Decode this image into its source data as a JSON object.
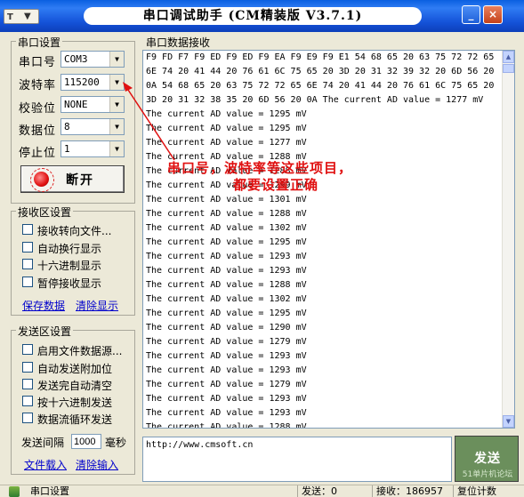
{
  "window": {
    "title": "串口调试助手 (CM精装版 V3.7.1)",
    "min_glyph": "_",
    "close_glyph": "×",
    "sysmenu_hammer": "T",
    "sysmenu_chevron": "▼"
  },
  "serial": {
    "group_title": "串口设置",
    "fields": [
      {
        "label": "串口号",
        "value": "COM3"
      },
      {
        "label": "波特率",
        "value": "115200"
      },
      {
        "label": "校验位",
        "value": "NONE"
      },
      {
        "label": "数据位",
        "value": "8"
      },
      {
        "label": "停止位",
        "value": "1"
      }
    ],
    "combo_arrow": "▼",
    "connect_button": "断开"
  },
  "recv_settings": {
    "group_title": "接收区设置",
    "options": [
      "接收转向文件...",
      "自动换行显示",
      "十六进制显示",
      "暂停接收显示"
    ],
    "save_link": "保存数据",
    "clear_link": "清除显示"
  },
  "send_settings": {
    "group_title": "发送区设置",
    "options": [
      "启用文件数据源...",
      "自动发送附加位",
      "发送完自动清空",
      "按十六进制发送",
      "数据流循环发送"
    ],
    "interval_label": "发送间隔",
    "interval_value": "1000",
    "interval_unit": "毫秒",
    "load_file_link": "文件载入",
    "clear_input_link": "清除输入"
  },
  "recv_area": {
    "group_title": "串口数据接收",
    "lines": [
      "F9 FD F7 F9 ED F9 ED F9 EA F9 E9 F9 E1 54 68 65 20 63 75 72 72 65",
      "6E 74 20 41 44 20 76 61 6C 75 65 20 3D 20 31 32 39 32 20 6D 56 20",
      "0A 54 68 65 20 63 75 72 72 65 6E 74 20 41 44 20 76 61 6C 75 65 20",
      "3D 20 31 32 38 35 20 6D 56 20 0A The current AD value = 1277 mV",
      "The current AD value = 1295 mV",
      "The current AD value = 1295 mV",
      "The current AD value = 1277 mV",
      "The current AD value = 1288 mV",
      "The current AD value = 1288 mV",
      "The current AD value = 1299 mV",
      "The current AD value = 1301 mV",
      "The current AD value = 1288 mV",
      "The current AD value = 1302 mV",
      "The current AD value = 1295 mV",
      "The current AD value = 1293 mV",
      "The current AD value = 1293 mV",
      "The current AD value = 1288 mV",
      "The current AD value = 1302 mV",
      "The current AD value = 1295 mV",
      "The current AD value = 1290 mV",
      "The current AD value = 1279 mV",
      "The current AD value = 1293 mV",
      "The current AD value = 1293 mV",
      "The current AD value = 1279 mV",
      "The current AD value = 1293 mV",
      "The current AD value = 1293 mV",
      "The current AD value = 1288 mV"
    ],
    "annotation_line1": "串口号，波特率等这些项目，",
    "annotation_line2": "都要设置正确"
  },
  "send_area": {
    "text": "http://www.cmsoft.cn",
    "send_button": "发送",
    "watermark": "51单片机论坛"
  },
  "statusbar": {
    "port_label": "串口设置",
    "sent": "发送：0",
    "received": "接收：186957",
    "reset_count": "复位计数"
  },
  "colors": {
    "titlebar": "#1f5fd8",
    "annotation": "#e01010",
    "send_button": "#6b8f5c",
    "link": "#0000cc"
  }
}
